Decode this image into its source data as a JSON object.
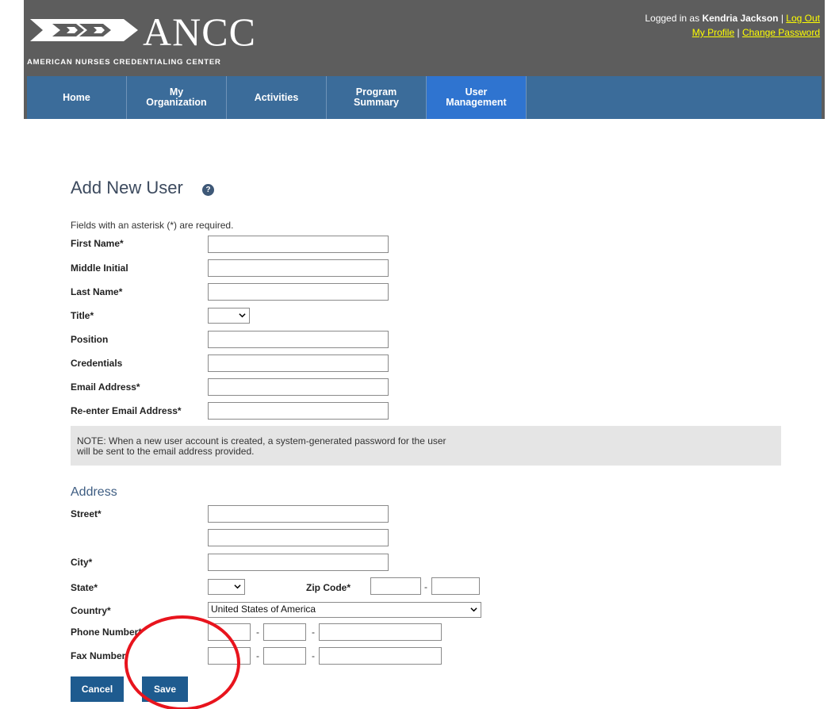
{
  "brand": {
    "name": "ANCC",
    "subtitle": "AMERICAN NURSES CREDENTIALING CENTER"
  },
  "user_box": {
    "logged_in_prefix": "Logged in as",
    "user_name": "Kendria Jackson",
    "separator": "|",
    "logout": "Log Out",
    "my_profile": "My Profile",
    "change_password": "Change Password"
  },
  "nav": {
    "items": [
      {
        "label": "Home",
        "active": false
      },
      {
        "label": "My\nOrganization",
        "active": false
      },
      {
        "label": "Activities",
        "active": false
      },
      {
        "label": "Program\nSummary",
        "active": false
      },
      {
        "label": "User\nManagement",
        "active": true
      }
    ]
  },
  "page": {
    "title": "Add New User",
    "help_icon": "?",
    "required_note": "Fields with an asterisk (*) are required."
  },
  "form": {
    "first_name_label": "First Name*",
    "middle_initial_label": "Middle Initial",
    "last_name_label": "Last Name*",
    "title_label": "Title*",
    "title_value": "",
    "position_label": "Position",
    "credentials_label": "Credentials",
    "email_label": "Email Address*",
    "reenter_email_label": "Re-enter Email Address*",
    "note": "NOTE: When a new user account is created, a system-generated password for the user will be sent to the email address provided."
  },
  "address": {
    "section_title": "Address",
    "street_label": "Street*",
    "city_label": "City*",
    "state_label": "State*",
    "state_value": "",
    "zip_label": "Zip Code*",
    "country_label": "Country*",
    "country_value": "United States of America",
    "phone_label": "Phone Number*",
    "fax_label": "Fax Number",
    "dash": "-"
  },
  "buttons": {
    "cancel": "Cancel",
    "save": "Save"
  },
  "colors": {
    "header_bg": "#5d5d5d",
    "nav_bg": "#3b6c9a",
    "nav_active": "#2f74d0",
    "link_yellow": "#ffff00",
    "button_bg": "#1e5b8f",
    "annotation_circle": "#e8141d"
  }
}
